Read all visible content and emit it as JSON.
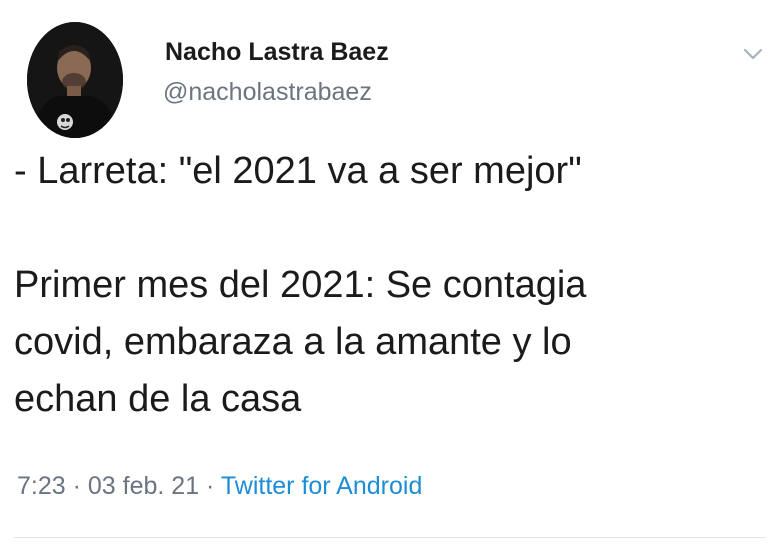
{
  "author": {
    "name": "Nacho Lastra Baez",
    "handle": "@nacholastrabaez"
  },
  "tweet": {
    "line1": "- Larreta: \"el 2021 va a ser mejor\"",
    "line2": "Primer mes del 2021: Se contagia",
    "line3": "covid, embaraza a la amante y lo",
    "line4": "echan de la casa"
  },
  "meta": {
    "time": "7:23",
    "sep1": " · ",
    "date": "03 feb. 21",
    "sep2": " · ",
    "source": "Twitter for Android"
  },
  "icons": {
    "menu": "chevron-down-icon",
    "avatar": "profile-photo"
  },
  "colors": {
    "text": "#1b1b1b",
    "secondary": "#6b7480",
    "link": "#1d8ed6"
  }
}
